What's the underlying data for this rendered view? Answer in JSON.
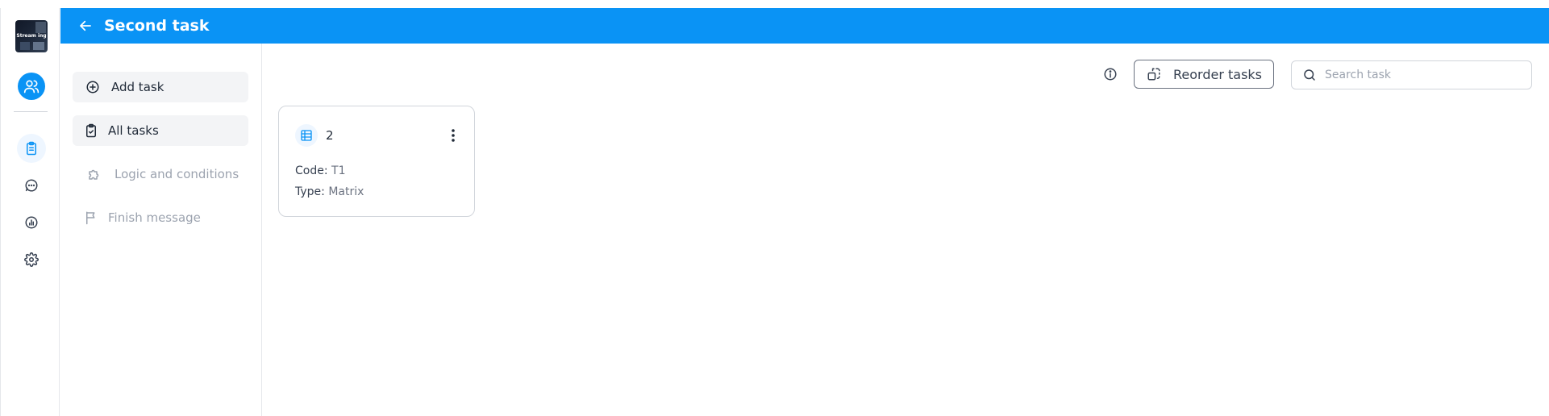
{
  "app": {
    "logo_text": "Stream ing"
  },
  "header": {
    "title": "Second task"
  },
  "rail": {
    "items": [
      {
        "name": "tasks-icon",
        "active": true
      },
      {
        "name": "chat-icon",
        "active": false
      },
      {
        "name": "analytics-icon",
        "active": false
      },
      {
        "name": "settings-icon",
        "active": false
      }
    ]
  },
  "subnav": {
    "add_task": "Add task",
    "all_tasks": "All tasks",
    "logic": "Logic and conditions",
    "finish": "Finish message"
  },
  "toolbar": {
    "reorder_label": "Reorder tasks",
    "search_placeholder": "Search task"
  },
  "tasks": [
    {
      "number": "2",
      "code_label": "Code:",
      "code": "T1",
      "type_label": "Type:",
      "type": "Matrix",
      "icon": "table-grid-icon"
    }
  ],
  "colors": {
    "primary": "#0a93f5",
    "sidebar_active_bg": "#f3f4f6",
    "muted_text": "#9ca3af"
  }
}
